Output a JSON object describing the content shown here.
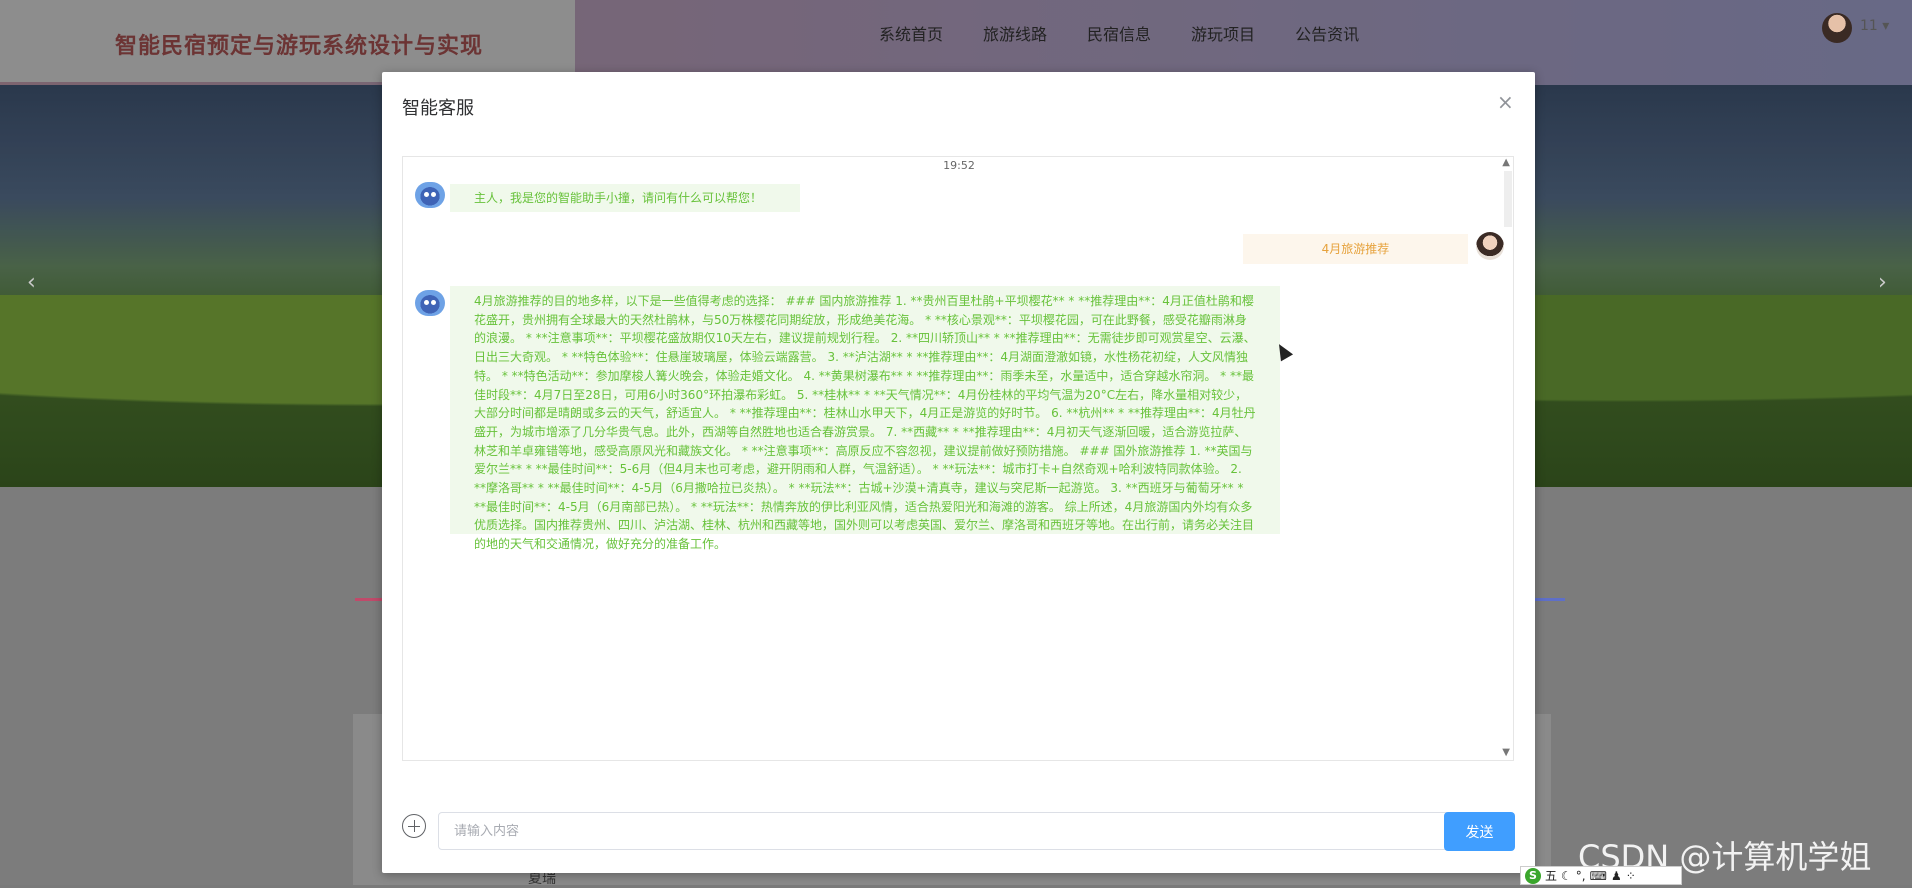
{
  "header": {
    "brand": "智能民宿预定与游玩系统设计与实现",
    "nav": [
      "系统首页",
      "旅游线路",
      "民宿信息",
      "游玩项目",
      "公告资讯"
    ],
    "user_name": "11"
  },
  "banner": {
    "prev_icon": "chevron-left-icon",
    "next_icon": "chevron-right-icon"
  },
  "background": {
    "bottom_text": "夏瑞"
  },
  "modal": {
    "title": "智能客服",
    "close_symbol": "×",
    "timestamp": "19:52",
    "messages": [
      {
        "role": "bot",
        "text": "主人，我是您的智能助手小撞，请问有什么可以帮您！"
      },
      {
        "role": "user",
        "text": "4月旅游推荐"
      },
      {
        "role": "bot",
        "text": "4月旅游推荐的目的地多样，以下是一些值得考虑的选择： ### 国内旅游推荐 1. **贵州百里杜鹃+平坝樱花** * **推荐理由**：4月正值杜鹃和樱花盛开，贵州拥有全球最大的天然杜鹃林，与50万株樱花同期绽放，形成绝美花海。 * **核心景观**：平坝樱花园，可在此野餐，感受花瓣雨淋身的浪漫。 * **注意事项**：平坝樱花盛放期仅10天左右，建议提前规划行程。 2. **四川轿顶山** * **推荐理由**：无需徒步即可观赏星空、云瀑、日出三大奇观。 * **特色体验**：住悬崖玻璃屋，体验云端露营。 3. **泸沽湖** * **推荐理由**：4月湖面澄澈如镜，水性杨花初绽，人文风情独特。 * **特色活动**：参加摩梭人篝火晚会，体验走婚文化。 4. **黄果树瀑布** * **推荐理由**：雨季未至，水量适中，适合穿越水帘洞。 * **最佳时段**：4月7日至28日，可用6小时360°环拍瀑布彩虹。 5. **桂林** * **天气情况**：4月份桂林的平均气温为20°C左右，降水量相对较少，大部分时间都是晴朗或多云的天气，舒适宜人。 * **推荐理由**：桂林山水甲天下，4月正是游览的好时节。 6. **杭州** * **推荐理由**：4月牡丹盛开，为城市增添了几分华贵气息。此外，西湖等自然胜地也适合春游赏景。 7. **西藏** * **推荐理由**：4月初天气逐渐回暖，适合游览拉萨、林芝和羊卓雍错等地，感受高原风光和藏族文化。 * **注意事项**：高原反应不容忽视，建议提前做好预防措施。 ### 国外旅游推荐 1. **英国与爱尔兰** * **最佳时间**：5-6月（但4月末也可考虑，避开阴雨和人群，气温舒适）。 * **玩法**：城市打卡+自然奇观+哈利波特同款体验。 2. **摩洛哥** * **最佳时间**：4-5月（6月撒哈拉已炎热）。 * **玩法**：古城+沙漠+清真寺，建议与突尼斯一起游览。 3. **西班牙与葡萄牙** * **最佳时间**：4-5月（6月南部已热）。 * **玩法**：热情奔放的伊比利亚风情，适合热爱阳光和海滩的游客。 综上所述，4月旅游国内外均有众多优质选择。国内推荐贵州、四川、泸沽湖、桂林、杭州和西藏等地，国外则可以考虑英国、爱尔兰、摩洛哥和西班牙等地。在出行前，请务必关注目的地的天气和交通情况，做好充分的准备工作。"
      }
    ],
    "input_placeholder": "请输入内容",
    "send_label": "发送"
  },
  "watermark": "CSDN @计算机学姐",
  "ime": {
    "label": "五"
  }
}
